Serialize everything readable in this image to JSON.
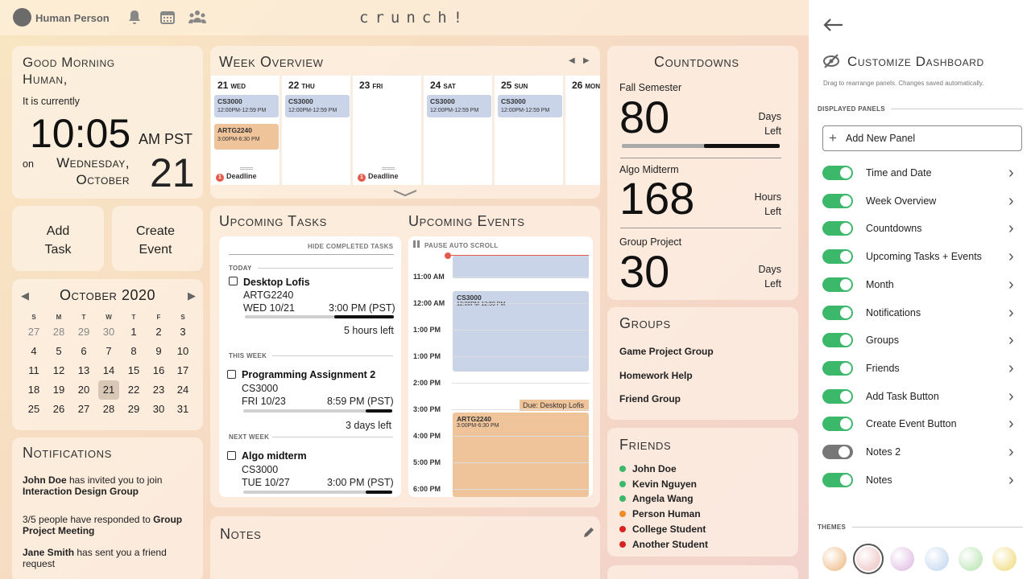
{
  "header": {
    "user": "Human Person",
    "logo": "crunch!"
  },
  "greeting": {
    "title": "Good Morning Human,",
    "currently": "It is currently",
    "time": "10:05",
    "ampm": "AM PST",
    "on": "on",
    "weekday": "Wednesday,",
    "month": "October",
    "day": "21"
  },
  "buttons": {
    "add_task": "Add Task",
    "create_event": "Create Event"
  },
  "calendar": {
    "title": "October 2020",
    "headers": [
      "S",
      "M",
      "T",
      "W",
      "T",
      "F",
      "S"
    ],
    "weeks": [
      [
        "27",
        "28",
        "29",
        "30",
        "1",
        "2",
        "3"
      ],
      [
        "4",
        "5",
        "6",
        "7",
        "8",
        "9",
        "10"
      ],
      [
        "11",
        "12",
        "13",
        "14",
        "15",
        "16",
        "17"
      ],
      [
        "18",
        "19",
        "20",
        "21",
        "22",
        "23",
        "24"
      ],
      [
        "25",
        "26",
        "27",
        "28",
        "29",
        "30",
        "31"
      ]
    ]
  },
  "notifications": {
    "title": "Notifications",
    "items": [
      {
        "bold": "John Doe",
        "text": " has invited you to join ",
        "bold2": "Interaction Design Group"
      },
      {
        "bold": "",
        "text": "3/5 people have responded to ",
        "bold2": "Group Project Meeting"
      },
      {
        "bold": "Jane Smith",
        "text": " has sent you a friend request",
        "bold2": ""
      }
    ]
  },
  "week": {
    "title": "Week Overview",
    "days": [
      {
        "num": "21",
        "name": "WED"
      },
      {
        "num": "22",
        "name": "THU"
      },
      {
        "num": "23",
        "name": "FRI"
      },
      {
        "num": "24",
        "name": "SAT"
      },
      {
        "num": "25",
        "name": "SUN"
      },
      {
        "num": "26",
        "name": "MON"
      }
    ],
    "event_cs": "CS3000",
    "event_cs_time": "12:00PM-12:59 PM",
    "event_artg": "ARTG2240",
    "event_artg_time": "3:00PM-6:30 PM",
    "deadline": "Deadline",
    "deadline_count": "1"
  },
  "tasks": {
    "title": "Upcoming Tasks",
    "hide": "HIDE COMPLETED TASKS",
    "today": "TODAY",
    "this_week": "THIS WEEK",
    "next_week": "NEXT WEEK",
    "items": [
      {
        "name": "Desktop Lofis",
        "course": "ARTG2240",
        "date": "WED 10/21",
        "time": "3:00 PM (PST)",
        "left": "5 hours left",
        "progress": 0.4
      },
      {
        "name": "Programming Assignment 2",
        "course": "CS3000",
        "date": "FRI 10/23",
        "time": "8:59 PM (PST)",
        "left": "3 days left",
        "progress": 0.18
      },
      {
        "name": "Algo midterm",
        "course": "CS3000",
        "date": "TUE 10/27",
        "time": "3:00 PM (PST)",
        "left": "",
        "progress": 0.18
      }
    ]
  },
  "events": {
    "title": "Upcoming Events",
    "pause": "PAUSE AUTO SCROLL",
    "hours": [
      "11:00 AM",
      "12:00 AM",
      "1:00 PM",
      "1:00 PM",
      "2:00 PM",
      "3:00 PM",
      "4:00 PM",
      "5:00 PM",
      "6:00 PM"
    ],
    "cs": "CS3000",
    "cs_time": "12:00PM-12:59 PM",
    "due": "Due: Desktop Lofis",
    "artg": "ARTG2240",
    "artg_time": "3:00PM-6:30 PM"
  },
  "notes": {
    "title": "Notes"
  },
  "countdowns": {
    "title": "Countdowns",
    "items": [
      {
        "label": "Fall Semester",
        "value": "80",
        "unit1": "Days",
        "unit2": "Left",
        "progress": 0.48
      },
      {
        "label": "Algo Midterm",
        "value": "168",
        "unit1": "Hours",
        "unit2": "Left"
      },
      {
        "label": "Group Project",
        "value": "30",
        "unit1": "Days",
        "unit2": "Left"
      }
    ]
  },
  "groups": {
    "title": "Groups",
    "items": [
      "Game Project Group",
      "Homework Help",
      "Friend Group"
    ]
  },
  "friends": {
    "title": "Friends",
    "items": [
      {
        "name": "John Doe",
        "color": "#3bb86a"
      },
      {
        "name": "Kevin Nguyen",
        "color": "#3bb86a"
      },
      {
        "name": "Angela Wang",
        "color": "#3bb86a"
      },
      {
        "name": "Person Human",
        "color": "#f08a24"
      },
      {
        "name": "College Student",
        "color": "#d8231f"
      },
      {
        "name": "Another Student",
        "color": "#d8231f"
      }
    ]
  },
  "sidebar": {
    "title": "Customize Dashboard",
    "subtitle": "Drag to rearrange panels. Changes saved automatically.",
    "displayed": "DISPLAYED PANELS",
    "add": "Add New Panel",
    "themes": "THEMES",
    "panels": [
      {
        "label": "Time and Date",
        "on": true
      },
      {
        "label": "Week Overview",
        "on": true
      },
      {
        "label": "Countdowns",
        "on": true
      },
      {
        "label": "Upcoming Tasks + Events",
        "on": true
      },
      {
        "label": "Month",
        "on": true
      },
      {
        "label": "Notifications",
        "on": true
      },
      {
        "label": "Groups",
        "on": true
      },
      {
        "label": "Friends",
        "on": true
      },
      {
        "label": "Add Task Button",
        "on": true
      },
      {
        "label": "Create Event Button",
        "on": true
      },
      {
        "label": "Notes 2",
        "on": false
      },
      {
        "label": "Notes",
        "on": true
      }
    ],
    "theme_colors": [
      "#f3c9a0",
      "#f1cfcf",
      "#e6cbe8",
      "#cfdff2",
      "#c8eac3",
      "#f3e39a"
    ]
  }
}
